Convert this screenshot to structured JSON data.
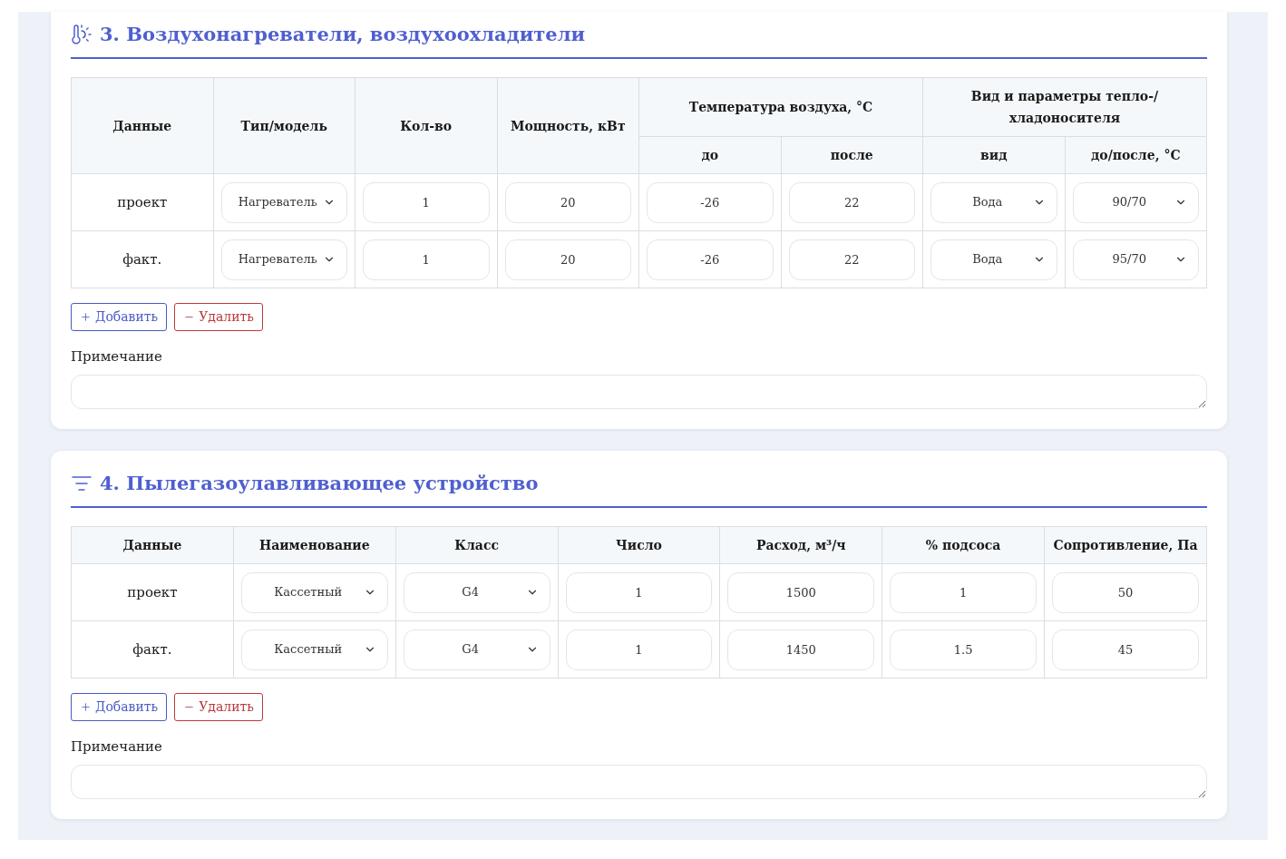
{
  "sections": [
    {
      "kind": "heater",
      "title": "3. Воздухонагреватели, воздухоохладители",
      "table": {
        "header_rows": [
          [
            {
              "label": "Данные",
              "rowspan": 2
            },
            {
              "label": "Тип/модель",
              "rowspan": 2
            },
            {
              "label": "Кол-во",
              "rowspan": 2
            },
            {
              "label": "Мощность, кВт",
              "rowspan": 2
            },
            {
              "label": "Температура воздуха, °C",
              "colspan": 2
            },
            {
              "label": "Вид и параметры тепло-/хладоносителя",
              "colspan": 2
            }
          ],
          [
            {
              "label": "до"
            },
            {
              "label": "после"
            },
            {
              "label": "вид"
            },
            {
              "label": "до/после, °C"
            }
          ]
        ],
        "rows": [
          {
            "cells": [
              {
                "kind": "text",
                "value": "проект"
              },
              {
                "kind": "select",
                "value": "Нагреватель"
              },
              {
                "kind": "input",
                "value": "1"
              },
              {
                "kind": "input",
                "value": "20"
              },
              {
                "kind": "input",
                "value": "-26"
              },
              {
                "kind": "input",
                "value": "22"
              },
              {
                "kind": "select",
                "value": "Вода"
              },
              {
                "kind": "select",
                "value": "90/70"
              }
            ]
          },
          {
            "cells": [
              {
                "kind": "text",
                "value": "факт."
              },
              {
                "kind": "select",
                "value": "Нагреватель"
              },
              {
                "kind": "input",
                "value": "1"
              },
              {
                "kind": "input",
                "value": "20"
              },
              {
                "kind": "input",
                "value": "-26"
              },
              {
                "kind": "input",
                "value": "22"
              },
              {
                "kind": "select",
                "value": "Вода"
              },
              {
                "kind": "select",
                "value": "95/70"
              }
            ]
          }
        ]
      },
      "buttons": [
        {
          "kind": "add",
          "label": "Добавить"
        },
        {
          "kind": "remove",
          "label": "Удалить"
        }
      ],
      "note": {
        "label": "Примечание"
      }
    },
    {
      "kind": "filter",
      "title": "4. Пылегазоулавливающее устройство",
      "table": {
        "header_rows": [
          [
            {
              "label": "Данные"
            },
            {
              "label": "Наименование"
            },
            {
              "label": "Класс"
            },
            {
              "label": "Число"
            },
            {
              "label": "Расход, м³/ч"
            },
            {
              "label": "% подсоса"
            },
            {
              "label": "Сопротивление, Па"
            }
          ]
        ],
        "rows": [
          {
            "cells": [
              {
                "kind": "text",
                "value": "проект"
              },
              {
                "kind": "select",
                "value": "Кассетный"
              },
              {
                "kind": "select",
                "value": "G4"
              },
              {
                "kind": "input",
                "value": "1"
              },
              {
                "kind": "input",
                "value": "1500"
              },
              {
                "kind": "input",
                "value": "1"
              },
              {
                "kind": "input",
                "value": "50"
              }
            ]
          },
          {
            "cells": [
              {
                "kind": "text",
                "value": "факт."
              },
              {
                "kind": "select",
                "value": "Кассетный"
              },
              {
                "kind": "select",
                "value": "G4"
              },
              {
                "kind": "input",
                "value": "1"
              },
              {
                "kind": "input",
                "value": "1450"
              },
              {
                "kind": "input",
                "value": "1.5"
              },
              {
                "kind": "input",
                "value": "45"
              }
            ]
          }
        ]
      },
      "buttons": [
        {
          "kind": "add",
          "label": "Добавить"
        },
        {
          "kind": "remove",
          "label": "Удалить"
        }
      ],
      "note": {
        "label": "Примечание"
      }
    }
  ]
}
